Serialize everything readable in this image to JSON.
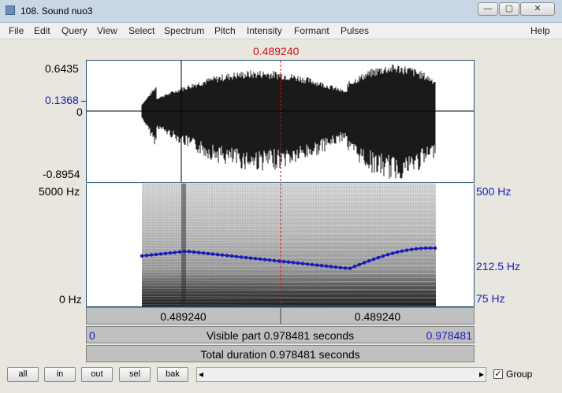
{
  "window": {
    "title": "108. Sound nuo3",
    "minimize_glyph": "—",
    "maximize_glyph": "▢",
    "close_glyph": "✕"
  },
  "menu": [
    "File",
    "Edit",
    "Query",
    "View",
    "Select",
    "Spectrum",
    "Pitch",
    "Intensity",
    "Formant",
    "Pulses"
  ],
  "help_label": "Help",
  "cursor_time": "0.489240",
  "waveform": {
    "ymax": "0.6435",
    "ycursor": "0.1368",
    "yzero": "0",
    "ymin": "-0.8954"
  },
  "spectrogram": {
    "fmax": "5000 Hz",
    "fmin": "0 Hz",
    "pitch_top": "500 Hz",
    "pitch_value": "212.5 Hz",
    "pitch_bottom": "75 Hz"
  },
  "time_bar": {
    "left": "0.489240",
    "right": "0.489240"
  },
  "visible_bar": {
    "start": "0",
    "label": "Visible part 0.978481 seconds",
    "end": "0.978481"
  },
  "total_bar": {
    "label": "Total duration 0.978481 seconds"
  },
  "buttons": [
    "all",
    "in",
    "out",
    "sel",
    "bak"
  ],
  "scroll_left": "◂",
  "scroll_right": "▸",
  "group": {
    "label": "Group",
    "checked": true
  },
  "colors": {
    "cursor": "#d01010",
    "pitch": "#1b1bb8",
    "frame": "#1d4f7b"
  }
}
